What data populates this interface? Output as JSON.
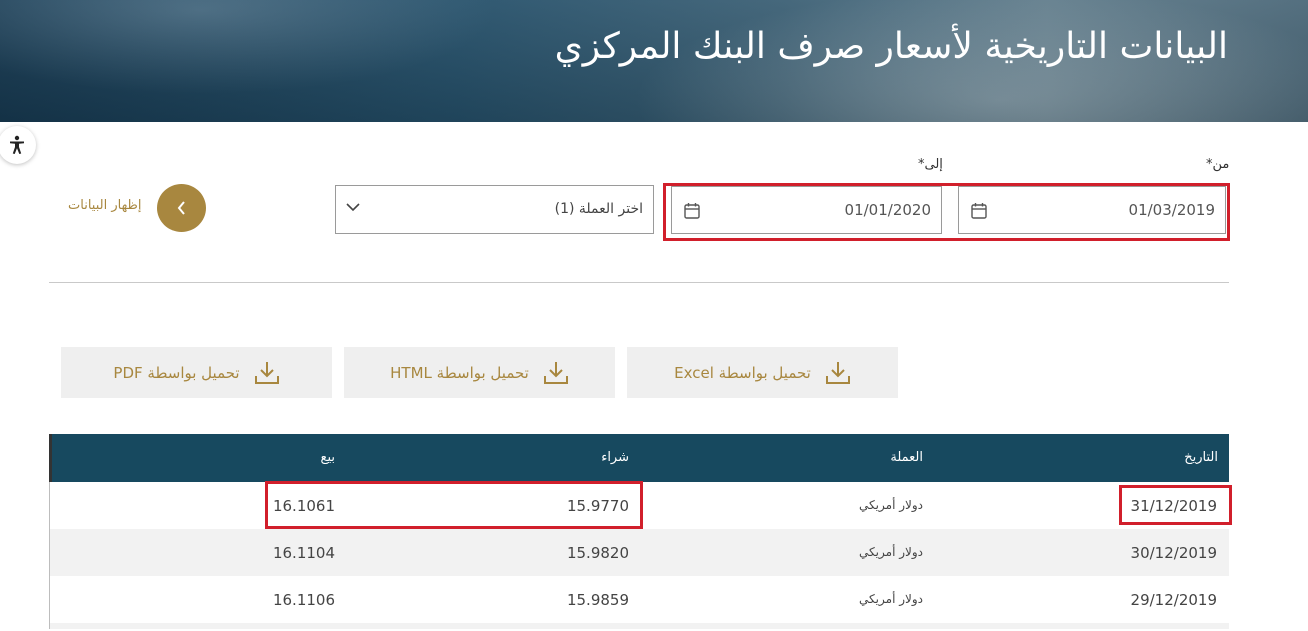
{
  "header": {
    "title": "البيانات التاريخية لأسعار صرف البنك المركزي"
  },
  "form": {
    "from_label": "من*",
    "to_label": "إلى*",
    "from_date": "01/03/2019",
    "to_date": "01/01/2020",
    "currency_select": "اختر العملة (1)",
    "show_data_label": "إظهار البيانات"
  },
  "downloads": {
    "excel": "تحميل بواسطة Excel",
    "html": "تحميل بواسطة HTML",
    "pdf": "تحميل بواسطة PDF"
  },
  "table": {
    "headers": {
      "date": "التاريخ",
      "currency": "العملة",
      "buy": "شراء",
      "sell": "بيع"
    },
    "rows": [
      {
        "date": "31/12/2019",
        "currency": "دولار أمريكي",
        "buy": "15.9770",
        "sell": "16.1061"
      },
      {
        "date": "30/12/2019",
        "currency": "دولار أمريكي",
        "buy": "15.9820",
        "sell": "16.1104"
      },
      {
        "date": "29/12/2019",
        "currency": "دولار أمريكي",
        "buy": "15.9859",
        "sell": "16.1106"
      }
    ]
  },
  "colors": {
    "accent_gold": "#a8873f",
    "table_header": "#17495f",
    "highlight_red": "#d11f2b"
  }
}
